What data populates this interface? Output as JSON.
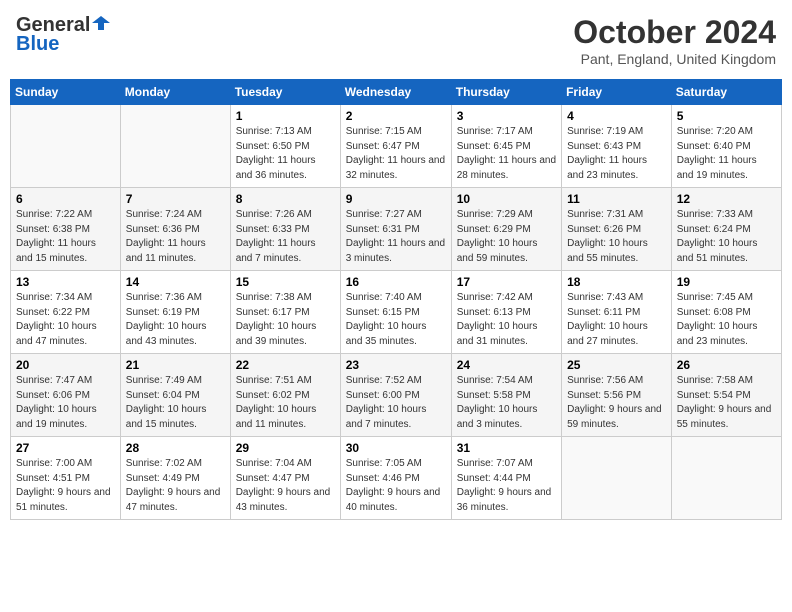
{
  "header": {
    "logo_general": "General",
    "logo_blue": "Blue",
    "title": "October 2024",
    "location": "Pant, England, United Kingdom"
  },
  "days_of_week": [
    "Sunday",
    "Monday",
    "Tuesday",
    "Wednesday",
    "Thursday",
    "Friday",
    "Saturday"
  ],
  "weeks": [
    [
      {
        "day": "",
        "info": ""
      },
      {
        "day": "",
        "info": ""
      },
      {
        "day": "1",
        "info": "Sunrise: 7:13 AM\nSunset: 6:50 PM\nDaylight: 11 hours and 36 minutes."
      },
      {
        "day": "2",
        "info": "Sunrise: 7:15 AM\nSunset: 6:47 PM\nDaylight: 11 hours and 32 minutes."
      },
      {
        "day": "3",
        "info": "Sunrise: 7:17 AM\nSunset: 6:45 PM\nDaylight: 11 hours and 28 minutes."
      },
      {
        "day": "4",
        "info": "Sunrise: 7:19 AM\nSunset: 6:43 PM\nDaylight: 11 hours and 23 minutes."
      },
      {
        "day": "5",
        "info": "Sunrise: 7:20 AM\nSunset: 6:40 PM\nDaylight: 11 hours and 19 minutes."
      }
    ],
    [
      {
        "day": "6",
        "info": "Sunrise: 7:22 AM\nSunset: 6:38 PM\nDaylight: 11 hours and 15 minutes."
      },
      {
        "day": "7",
        "info": "Sunrise: 7:24 AM\nSunset: 6:36 PM\nDaylight: 11 hours and 11 minutes."
      },
      {
        "day": "8",
        "info": "Sunrise: 7:26 AM\nSunset: 6:33 PM\nDaylight: 11 hours and 7 minutes."
      },
      {
        "day": "9",
        "info": "Sunrise: 7:27 AM\nSunset: 6:31 PM\nDaylight: 11 hours and 3 minutes."
      },
      {
        "day": "10",
        "info": "Sunrise: 7:29 AM\nSunset: 6:29 PM\nDaylight: 10 hours and 59 minutes."
      },
      {
        "day": "11",
        "info": "Sunrise: 7:31 AM\nSunset: 6:26 PM\nDaylight: 10 hours and 55 minutes."
      },
      {
        "day": "12",
        "info": "Sunrise: 7:33 AM\nSunset: 6:24 PM\nDaylight: 10 hours and 51 minutes."
      }
    ],
    [
      {
        "day": "13",
        "info": "Sunrise: 7:34 AM\nSunset: 6:22 PM\nDaylight: 10 hours and 47 minutes."
      },
      {
        "day": "14",
        "info": "Sunrise: 7:36 AM\nSunset: 6:19 PM\nDaylight: 10 hours and 43 minutes."
      },
      {
        "day": "15",
        "info": "Sunrise: 7:38 AM\nSunset: 6:17 PM\nDaylight: 10 hours and 39 minutes."
      },
      {
        "day": "16",
        "info": "Sunrise: 7:40 AM\nSunset: 6:15 PM\nDaylight: 10 hours and 35 minutes."
      },
      {
        "day": "17",
        "info": "Sunrise: 7:42 AM\nSunset: 6:13 PM\nDaylight: 10 hours and 31 minutes."
      },
      {
        "day": "18",
        "info": "Sunrise: 7:43 AM\nSunset: 6:11 PM\nDaylight: 10 hours and 27 minutes."
      },
      {
        "day": "19",
        "info": "Sunrise: 7:45 AM\nSunset: 6:08 PM\nDaylight: 10 hours and 23 minutes."
      }
    ],
    [
      {
        "day": "20",
        "info": "Sunrise: 7:47 AM\nSunset: 6:06 PM\nDaylight: 10 hours and 19 minutes."
      },
      {
        "day": "21",
        "info": "Sunrise: 7:49 AM\nSunset: 6:04 PM\nDaylight: 10 hours and 15 minutes."
      },
      {
        "day": "22",
        "info": "Sunrise: 7:51 AM\nSunset: 6:02 PM\nDaylight: 10 hours and 11 minutes."
      },
      {
        "day": "23",
        "info": "Sunrise: 7:52 AM\nSunset: 6:00 PM\nDaylight: 10 hours and 7 minutes."
      },
      {
        "day": "24",
        "info": "Sunrise: 7:54 AM\nSunset: 5:58 PM\nDaylight: 10 hours and 3 minutes."
      },
      {
        "day": "25",
        "info": "Sunrise: 7:56 AM\nSunset: 5:56 PM\nDaylight: 9 hours and 59 minutes."
      },
      {
        "day": "26",
        "info": "Sunrise: 7:58 AM\nSunset: 5:54 PM\nDaylight: 9 hours and 55 minutes."
      }
    ],
    [
      {
        "day": "27",
        "info": "Sunrise: 7:00 AM\nSunset: 4:51 PM\nDaylight: 9 hours and 51 minutes."
      },
      {
        "day": "28",
        "info": "Sunrise: 7:02 AM\nSunset: 4:49 PM\nDaylight: 9 hours and 47 minutes."
      },
      {
        "day": "29",
        "info": "Sunrise: 7:04 AM\nSunset: 4:47 PM\nDaylight: 9 hours and 43 minutes."
      },
      {
        "day": "30",
        "info": "Sunrise: 7:05 AM\nSunset: 4:46 PM\nDaylight: 9 hours and 40 minutes."
      },
      {
        "day": "31",
        "info": "Sunrise: 7:07 AM\nSunset: 4:44 PM\nDaylight: 9 hours and 36 minutes."
      },
      {
        "day": "",
        "info": ""
      },
      {
        "day": "",
        "info": ""
      }
    ]
  ]
}
